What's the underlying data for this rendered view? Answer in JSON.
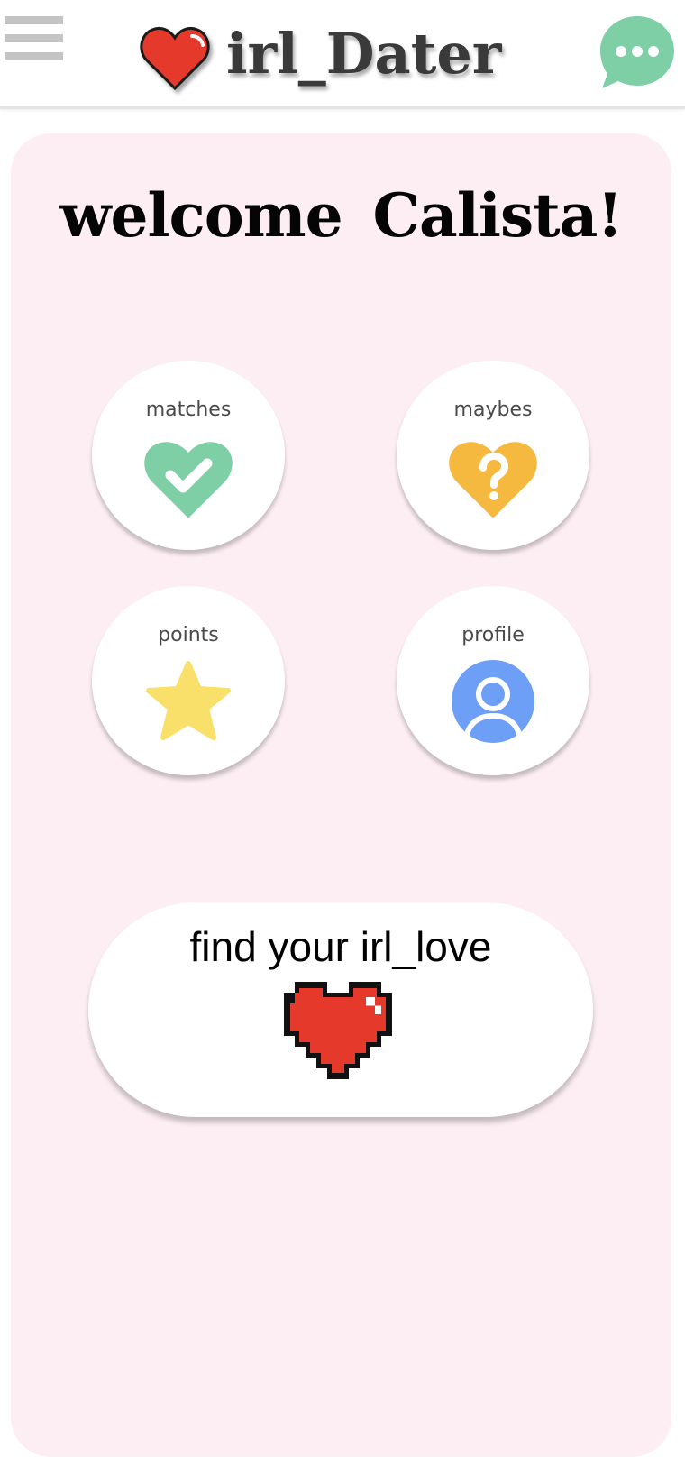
{
  "header": {
    "app_title": "irl_Dater",
    "menu_icon": "hamburger-menu-icon",
    "logo_icon": "heart-icon",
    "chat_icon": "chat-bubble-icon"
  },
  "main": {
    "welcome": "welcome Calista!",
    "tiles": [
      {
        "label": "matches",
        "icon": "heart-check-icon",
        "color": "#7fcfa6"
      },
      {
        "label": "maybes",
        "icon": "heart-question-icon",
        "color": "#f5b93f"
      },
      {
        "label": "points",
        "icon": "star-icon",
        "color": "#f8e06b"
      },
      {
        "label": "profile",
        "icon": "user-avatar-icon",
        "color": "#6e9ff7"
      }
    ],
    "cta": {
      "label": "find your irl_love",
      "icon": "pixel-heart-icon"
    }
  },
  "colors": {
    "card_background": "#fceef3",
    "heart_red": "#e5392b",
    "chat_green": "#7fcfa6"
  }
}
